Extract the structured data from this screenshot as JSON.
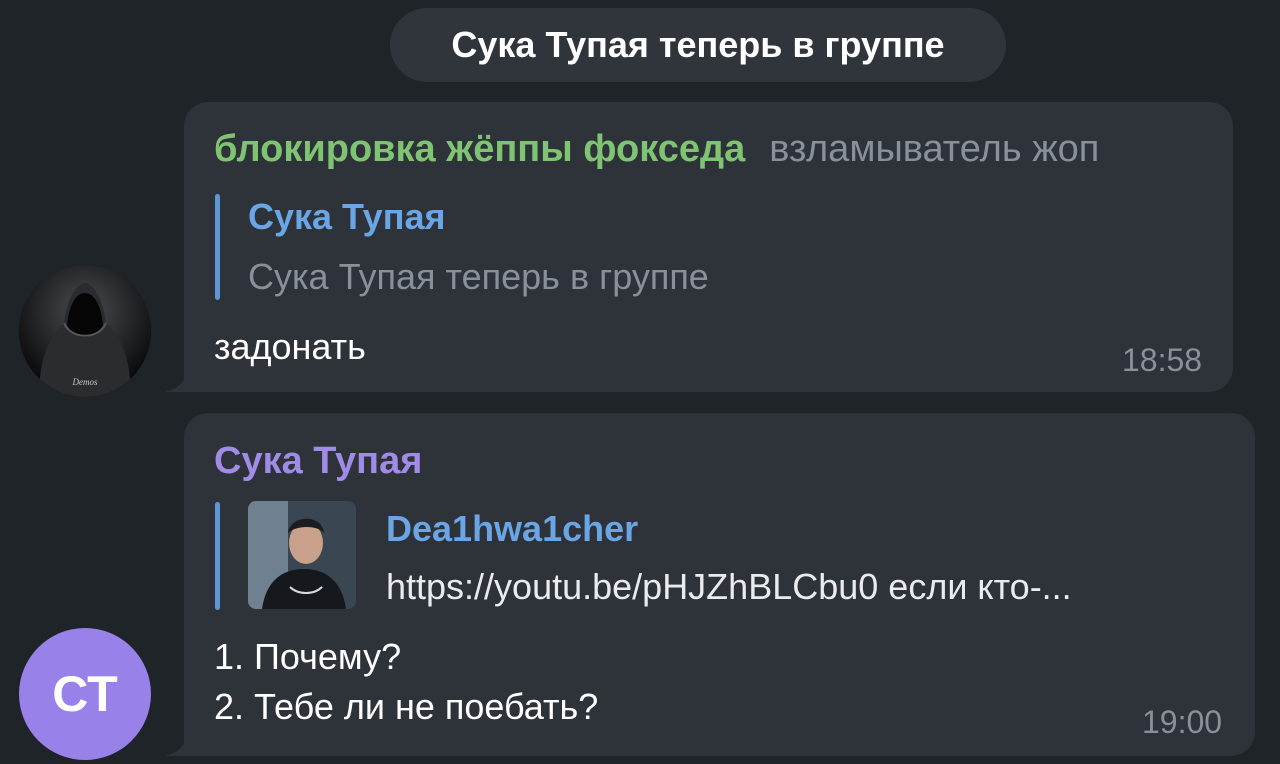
{
  "service_message": "Сука Тупая теперь в группе",
  "messages": [
    {
      "sender": "блокировка жёппы фокседа",
      "sender_title": "взламыватель жоп",
      "reply": {
        "name": "Сука Тупая",
        "text": "Сука Тупая теперь в группе"
      },
      "text": "задонать",
      "time": "18:58",
      "avatar_caption": "Demos"
    },
    {
      "sender": "Сука Тупая",
      "avatar_initials": "СТ",
      "reply": {
        "name": "Dea1hwa1cher",
        "text": "https://youtu.be/pHJZhBLCbu0 если кто-..."
      },
      "lines": [
        "1. Почему?",
        "2. Тебе ли не поебать?"
      ],
      "time": "19:00"
    }
  ],
  "colors": {
    "background": "#1f2428",
    "bubble": "#2e3239",
    "sender_green": "#7fc473",
    "sender_purple": "#a08ce6",
    "reply_accent": "#6aa5e6",
    "avatar_ct": "#9881e8"
  }
}
